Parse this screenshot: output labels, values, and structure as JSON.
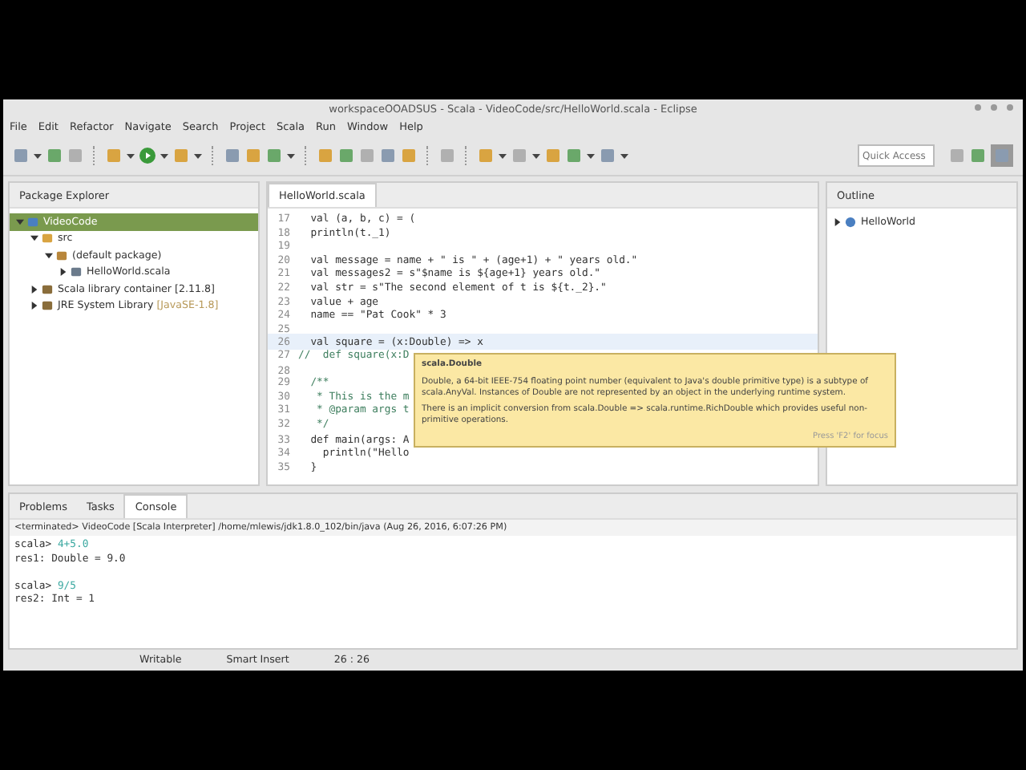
{
  "window": {
    "title": "workspaceOOADSUS - Scala - VideoCode/src/HelloWorld.scala - Eclipse"
  },
  "menu": [
    "File",
    "Edit",
    "Refactor",
    "Navigate",
    "Search",
    "Project",
    "Scala",
    "Run",
    "Window",
    "Help"
  ],
  "quick_access": {
    "placeholder": "Quick Access"
  },
  "package_explorer": {
    "title": "Package Explorer",
    "tree": [
      {
        "label": "VideoCode",
        "kind": "project",
        "selected": true,
        "expanded": true,
        "children": [
          {
            "label": "src",
            "kind": "folder",
            "selected": false,
            "expanded": true,
            "children": [
              {
                "label": "(default package)",
                "kind": "package",
                "selected": false,
                "expanded": true,
                "children": [
                  {
                    "label": "HelloWorld.scala",
                    "kind": "file",
                    "selected": false,
                    "expanded": false
                  }
                ]
              }
            ]
          },
          {
            "label": "Scala library container [2.11.8]",
            "kind": "library",
            "selected": false,
            "expanded": false
          },
          {
            "label": "JRE System Library",
            "suffix": "[JavaSE-1.8]",
            "kind": "library",
            "selected": false,
            "expanded": false
          }
        ]
      }
    ]
  },
  "editor": {
    "tab": "HelloWorld.scala",
    "lines": [
      {
        "num": "17",
        "text": "  val (a, b, c) = (",
        "kind": "code",
        "current": false
      },
      {
        "num": "18",
        "text": "  println(t._1)",
        "kind": "code",
        "current": false
      },
      {
        "num": "19",
        "kind": "code",
        "current": false
      },
      {
        "num": "20",
        "text": "  val message = name + \" is \" + (age+1) + \" years old.\"",
        "kind": "code",
        "current": false
      },
      {
        "num": "21",
        "text": "  val messages2 = s\"$name is ${age+1} years old.\"",
        "kind": "code",
        "current": false
      },
      {
        "num": "22",
        "text": "  val str = s\"The second element of t is ${t._2}.\"",
        "kind": "code",
        "current": false
      },
      {
        "num": "23",
        "text": "  value + age",
        "kind": "code",
        "current": false
      },
      {
        "num": "24",
        "text": "  name == \"Pat Cook\" * 3",
        "kind": "code",
        "current": false
      },
      {
        "num": "25",
        "kind": "code",
        "current": false
      },
      {
        "num": "26",
        "text": "  val square = (x:Double) => x",
        "kind": "code",
        "current": true
      },
      {
        "num": "27",
        "text": "//  def square(x:D",
        "kind": "comment",
        "current": false
      },
      {
        "num": "28",
        "kind": "code",
        "current": false
      },
      {
        "num": "29",
        "text": "  /**",
        "kind": "doc",
        "current": false
      },
      {
        "num": "30",
        "text": "   * This is the m",
        "kind": "doc",
        "current": false
      },
      {
        "num": "31",
        "text": "   * @param args t",
        "kind": "doc",
        "current": false
      },
      {
        "num": "32",
        "text": "   */",
        "kind": "doc",
        "current": false
      },
      {
        "num": "33",
        "text": "  def main(args: A",
        "kind": "code",
        "current": false
      },
      {
        "num": "34",
        "text": "    println(\"Hello",
        "kind": "code",
        "current": false
      },
      {
        "num": "35",
        "text": "  }",
        "kind": "code",
        "current": false
      }
    ]
  },
  "tooltip": {
    "title": "scala.Double",
    "paragraphs": [
      "Double, a 64-bit IEEE-754 floating point number (equivalent to Java's double primitive type) is a subtype of scala.AnyVal. Instances of Double are not represented by an object in the underlying runtime system.",
      "There is an implicit conversion from scala.Double => scala.runtime.RichDouble which provides useful non-primitive operations."
    ],
    "footer": "Press 'F2' for focus"
  },
  "outline": {
    "title": "Outline",
    "items": [
      {
        "label": "HelloWorld",
        "selected": false
      }
    ]
  },
  "bottom_tabs": [
    {
      "label": "Problems",
      "selected": false
    },
    {
      "label": "Tasks",
      "selected": false
    },
    {
      "label": "Console",
      "selected": true
    }
  ],
  "console": {
    "header": "<terminated> VideoCode [Scala Interpreter] /home/mlewis/jdk1.8.0_102/bin/java (Aug 26, 2016, 6:07:26 PM)",
    "lines": [
      {
        "kind": "input",
        "prompt": "scala>",
        "text": "4+5.0"
      },
      {
        "kind": "output",
        "text": "res1: Double = 9.0"
      },
      {
        "kind": "blank"
      },
      {
        "kind": "input",
        "prompt": "scala>",
        "text": "9/5"
      },
      {
        "kind": "output",
        "text": "res2: Int = 1"
      }
    ]
  },
  "status_bar": [
    "Writable",
    "Smart Insert",
    "26 : 26"
  ]
}
